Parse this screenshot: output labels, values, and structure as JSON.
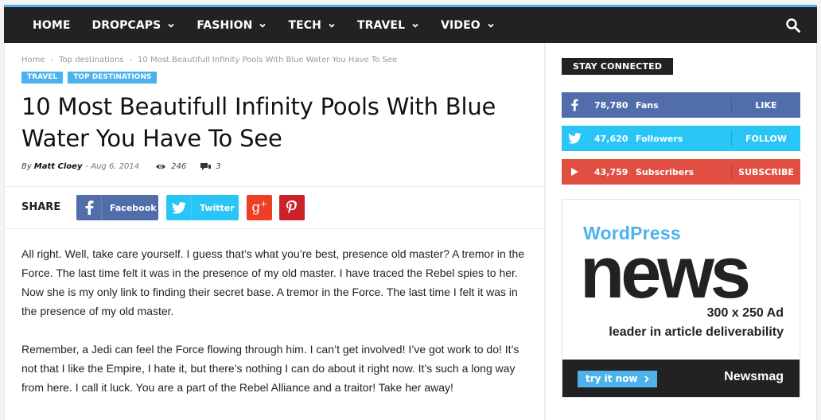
{
  "nav": {
    "items": [
      {
        "label": "HOME",
        "has_dropdown": false
      },
      {
        "label": "DROPCAPS",
        "has_dropdown": true
      },
      {
        "label": "FASHION",
        "has_dropdown": true
      },
      {
        "label": "TECH",
        "has_dropdown": true
      },
      {
        "label": "TRAVEL",
        "has_dropdown": true
      },
      {
        "label": "VIDEO",
        "has_dropdown": true
      }
    ],
    "search_icon": "search-icon",
    "accent_color": "#4db2ec"
  },
  "breadcrumb": {
    "home": "Home",
    "category": "Top destinations",
    "current": "10 Most Beautifull Infinity Pools With Blue Water You Have To See"
  },
  "categories": [
    "TRAVEL",
    "TOP DESTINATIONS"
  ],
  "article": {
    "title": "10 Most Beautifull Infinity Pools With Blue Water You Have To See",
    "by": "By",
    "author": "Matt Cloey",
    "date": "- Aug 6, 2014",
    "views": "246",
    "comments": "3",
    "paragraphs": [
      "All right. Well, take care yourself. I guess that’s what you’re best, presence old master? A tremor in the Force. The last time felt it was in the presence of my old master. I have traced the Rebel spies to her. Now she is my only link to finding their secret base. A tremor in the Force. The last time I felt it was in the presence of my old master.",
      "Remember, a Jedi can feel the Force flowing through him. I can’t get involved! I’ve got work to do! It’s not that I like the Empire, I hate it, but there’s nothing I can do about it right now. It’s such a long way from here. I call it luck. You are a part of the Rebel Alliance and a traitor! Take her away!"
    ]
  },
  "share": {
    "label": "SHARE",
    "facebook": "Facebook",
    "twitter": "Twitter",
    "colors": {
      "facebook": "#516eab",
      "twitter": "#29c5f6",
      "googleplus": "#eb4026",
      "pinterest": "#ca212a"
    }
  },
  "sidebar": {
    "stay_connected": "STAY CONNECTED",
    "social": [
      {
        "network": "facebook",
        "icon": "facebook-icon",
        "count": "78,780",
        "label": "Fans",
        "action": "LIKE",
        "color": "#516eab"
      },
      {
        "network": "twitter",
        "icon": "twitter-icon",
        "count": "47,620",
        "label": "Followers",
        "action": "FOLLOW",
        "color": "#29c5f6"
      },
      {
        "network": "youtube",
        "icon": "youtube-icon",
        "count": "43,759",
        "label": "Subscribers",
        "action": "SUBSCRIBE",
        "color": "#e14e42"
      }
    ],
    "ad": {
      "brand": "WordPress",
      "headline": "news",
      "size": "300 x 250 Ad",
      "tagline": "leader in article deliverability",
      "cta": "try it now",
      "logo": "Newsmag"
    }
  }
}
